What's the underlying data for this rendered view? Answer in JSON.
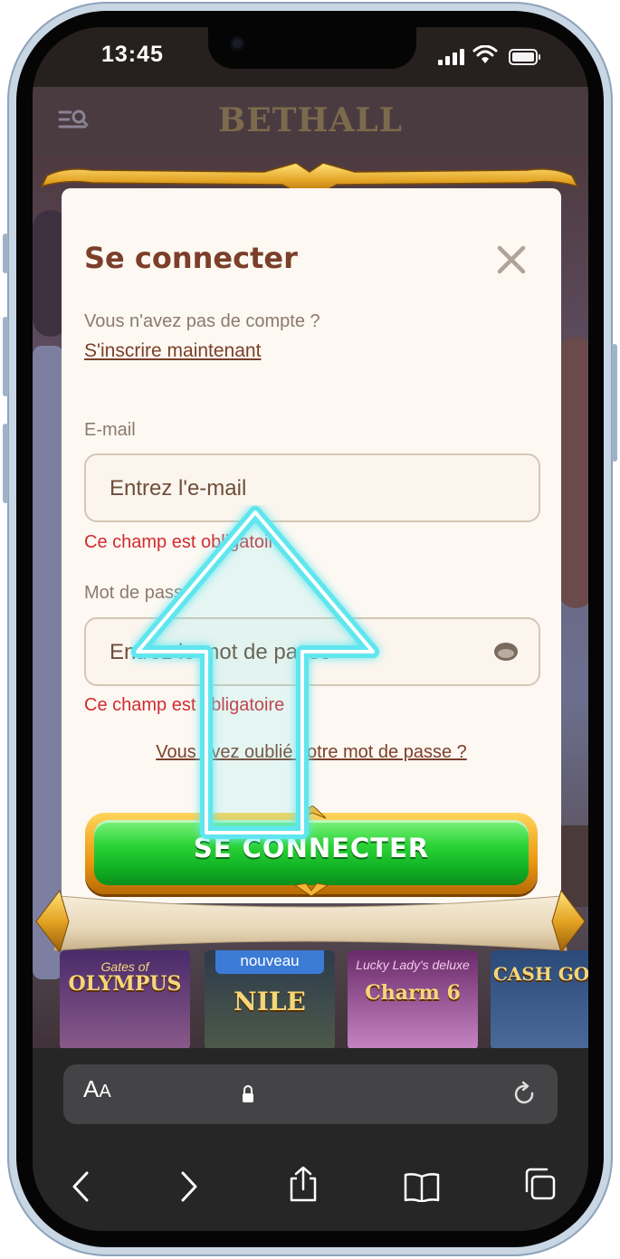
{
  "status_bar": {
    "time": "13:45"
  },
  "site": {
    "logo": "BETHALL",
    "games": [
      {
        "name": "OLYMPUS",
        "sub": "Gates of",
        "badge": ""
      },
      {
        "name": "NILE",
        "sub": "",
        "badge": "nouveau"
      },
      {
        "name": "Charm 6",
        "sub": "Lucky Lady's deluxe",
        "badge": ""
      },
      {
        "name": "CASH GODS",
        "sub": "",
        "badge": ""
      }
    ]
  },
  "modal": {
    "title": "Se connecter",
    "no_account_text": "Vous n'avez pas de compte ?",
    "signup_link": "S'inscrire maintenant",
    "email": {
      "label": "E-mail",
      "placeholder": "Entrez l'e-mail",
      "value": "",
      "error": "Ce champ est obligatoire"
    },
    "password": {
      "label": "Mot de passe",
      "placeholder": "Entrez le mot de passe",
      "value": "",
      "error": "Ce champ est obligatoire"
    },
    "forgot_password": "Vous avez oublié votre mot de passe ?",
    "login_button": "SE CONNECTER"
  },
  "browser": {
    "aa_label_big": "A",
    "aa_label_small": "A"
  },
  "colors": {
    "accent_brown": "#7b3f2a",
    "error_red": "#d02b32",
    "button_green": "#13b626",
    "arrow_cyan": "#5fe6ee"
  }
}
